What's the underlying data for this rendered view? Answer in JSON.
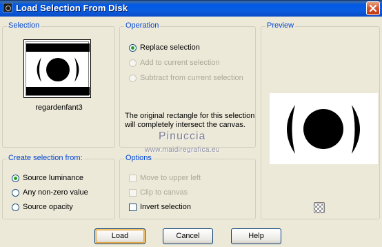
{
  "window": {
    "title": "Load Selection From Disk"
  },
  "selection": {
    "group_label": "Selection",
    "thumbnail_name": "regardenfant3"
  },
  "operation": {
    "group_label": "Operation",
    "options": [
      {
        "label": "Replace selection",
        "checked": true,
        "enabled": true
      },
      {
        "label": "Add to current selection",
        "checked": false,
        "enabled": false
      },
      {
        "label": "Subtract from current selection",
        "checked": false,
        "enabled": false
      }
    ],
    "info_line1": "The original rectangle for this selection",
    "info_line2": "will completely intersect the canvas."
  },
  "preview": {
    "group_label": "Preview"
  },
  "create_from": {
    "group_label": "Create selection from:",
    "options": [
      {
        "label": "Source luminance",
        "checked": true
      },
      {
        "label": "Any non-zero value",
        "checked": false
      },
      {
        "label": "Source opacity",
        "checked": false
      }
    ]
  },
  "options": {
    "group_label": "Options",
    "items": [
      {
        "label": "Move to upper left",
        "checked": false,
        "enabled": false
      },
      {
        "label": "Clip to canvas",
        "checked": false,
        "enabled": false
      },
      {
        "label": "Invert selection",
        "checked": false,
        "enabled": true
      }
    ]
  },
  "watermark": {
    "name": "Pinuccia",
    "site": "www.maidiregrafica.eu"
  },
  "buttons": {
    "load": "Load",
    "cancel": "Cancel",
    "help": "Help"
  },
  "icons": {
    "close": "close-icon",
    "app": "app-icon",
    "transparency": "checkerboard-icon"
  },
  "colors": {
    "title_bar": "#0058e6",
    "group_label": "#0046d5",
    "radio_checked": "#21a121"
  }
}
